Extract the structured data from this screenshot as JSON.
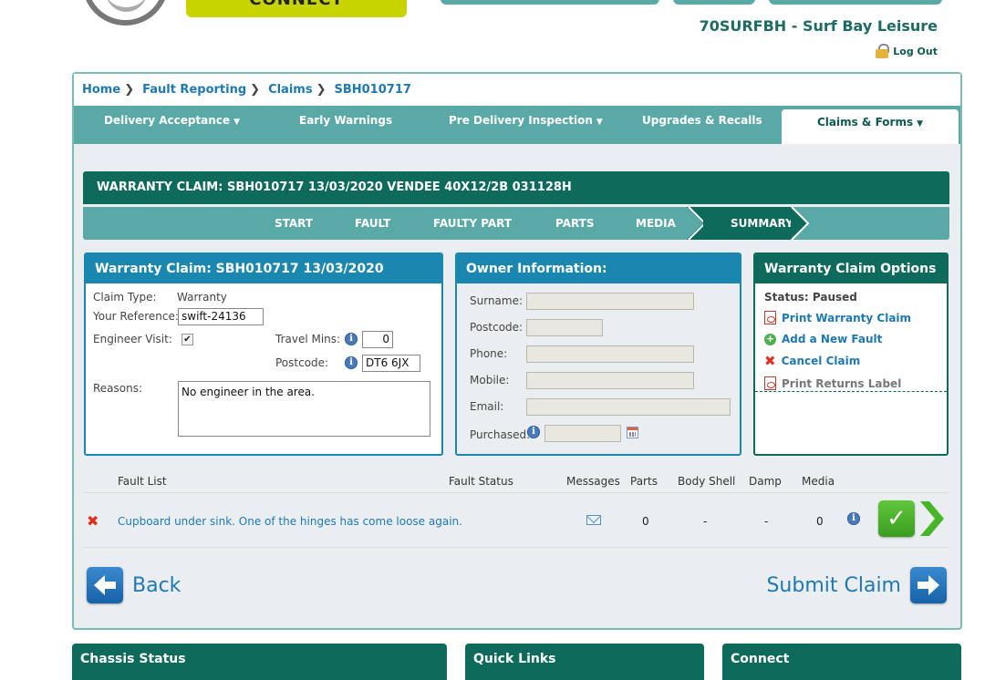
{
  "header": {
    "connect_label": "CONNECT",
    "dealer_name": "70SURFBH - Surf Bay Leisure",
    "logout_label": "Log Out"
  },
  "breadcrumb": [
    "Home",
    "Fault Reporting",
    "Claims",
    "SBH010717"
  ],
  "nav": {
    "items": [
      {
        "label": "Delivery Acceptance",
        "caret": true
      },
      {
        "label": "Early Warnings",
        "caret": false
      },
      {
        "label": "Pre Delivery Inspection",
        "caret": true
      },
      {
        "label": "Upgrades & Recalls",
        "caret": false
      },
      {
        "label": "Claims & Forms",
        "caret": true,
        "active": true
      }
    ]
  },
  "claim_title": "WARRANTY CLAIM: SBH010717 13/03/2020 VENDEE 40X12/2B 031128H",
  "steps": [
    "START",
    "FAULT",
    "FAULTY PART",
    "PARTS",
    "MEDIA",
    "SUMMARY"
  ],
  "claim_box": {
    "title": "Warranty Claim: SBH010717 13/03/2020",
    "claim_type_label": "Claim Type:",
    "claim_type_value": "Warranty",
    "your_reference_label": "Your Reference:",
    "your_reference_value": "swift-24136",
    "engineer_visit_label": "Engineer Visit:",
    "engineer_visit_checked": true,
    "travel_mins_label": "Travel Mins:",
    "travel_mins_value": "0",
    "postcode_label": "Postcode:",
    "postcode_value": "DT6 6JX",
    "reasons_label": "Reasons:",
    "reasons_value": "No engineer in the area."
  },
  "owner_box": {
    "title": "Owner Information:",
    "surname_label": "Surname:",
    "postcode_label": "Postcode:",
    "phone_label": "Phone:",
    "mobile_label": "Mobile:",
    "email_label": "Email:",
    "purchased_label": "Purchased:"
  },
  "options_box": {
    "title": "Warranty Claim Options",
    "status": "Status: Paused",
    "links": [
      "Print Warranty Claim",
      "Add a New Fault",
      "Cancel Claim",
      "Print Returns Label"
    ]
  },
  "fault_list": {
    "headers": {
      "fault_list": "Fault List",
      "fault_status": "Fault Status",
      "messages": "Messages",
      "parts": "Parts",
      "body_shell": "Body Shell",
      "damp": "Damp",
      "media": "Media"
    },
    "rows": [
      {
        "description": "Cupboard under sink. One of the hinges has come loose again.",
        "fault_status": "",
        "parts": "0",
        "body_shell": "-",
        "damp": "-",
        "media": "0"
      }
    ]
  },
  "buttons": {
    "back": "Back",
    "submit": "Submit Claim"
  },
  "bottom_panels": [
    "Chassis Status",
    "Quick Links",
    "Connect"
  ]
}
